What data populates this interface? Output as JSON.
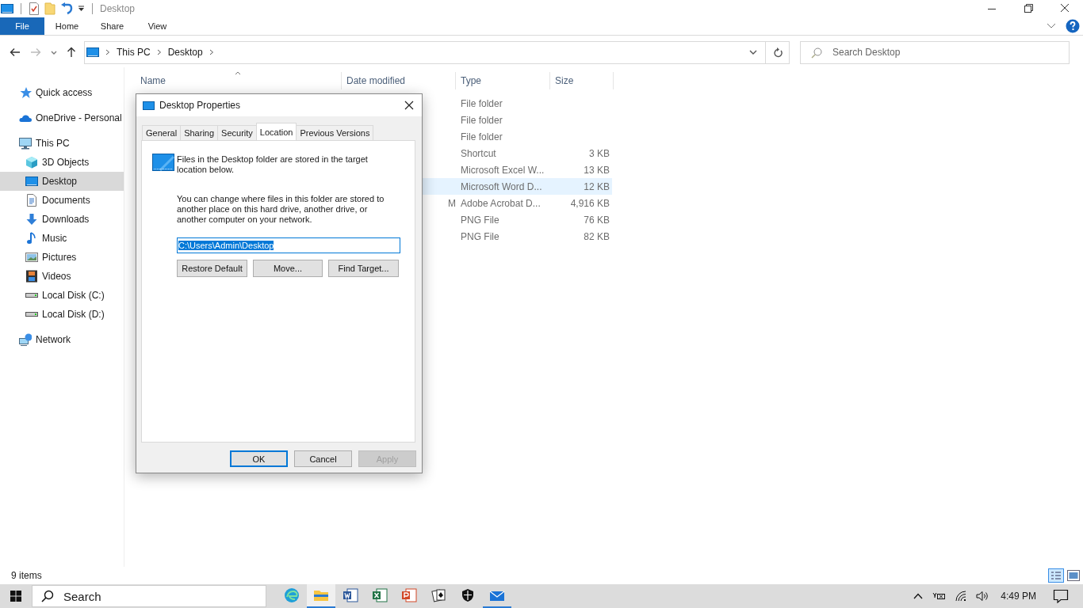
{
  "window": {
    "title": "Desktop"
  },
  "ribbon_tabs": [
    {
      "label": "File",
      "kind": "file",
      "selected": false
    },
    {
      "label": "Home",
      "kind": "tab",
      "selected": false
    },
    {
      "label": "Share",
      "kind": "tab",
      "selected": false
    },
    {
      "label": "View",
      "kind": "tab",
      "selected": false
    }
  ],
  "address": {
    "segments": [
      "This PC",
      "Desktop"
    ]
  },
  "search": {
    "placeholder": "Search Desktop"
  },
  "sidebar": {
    "items": [
      {
        "label": "Quick access",
        "kind": "star",
        "selected": false
      },
      {
        "label": "OneDrive - Personal",
        "kind": "cloud",
        "selected": false
      },
      {
        "label": "This PC",
        "kind": "pc",
        "selected": false,
        "children": [
          {
            "label": "3D Objects",
            "kind": "cube",
            "selected": false
          },
          {
            "label": "Desktop",
            "kind": "desktop",
            "selected": true
          },
          {
            "label": "Documents",
            "kind": "document",
            "selected": false
          },
          {
            "label": "Downloads",
            "kind": "download",
            "selected": false
          },
          {
            "label": "Music",
            "kind": "music",
            "selected": false
          },
          {
            "label": "Pictures",
            "kind": "picture",
            "selected": false
          },
          {
            "label": "Videos",
            "kind": "video",
            "selected": false
          },
          {
            "label": "Local Disk (C:)",
            "kind": "disk",
            "selected": false
          },
          {
            "label": "Local Disk (D:)",
            "kind": "disk",
            "selected": false
          }
        ]
      },
      {
        "label": "Network",
        "kind": "network",
        "selected": false
      }
    ]
  },
  "table": {
    "columns": [
      "Name",
      "Date modified",
      "Type",
      "Size"
    ],
    "rows": [
      {
        "type": "File folder",
        "selected": false
      },
      {
        "type": "File folder",
        "selected": false
      },
      {
        "type": "File folder",
        "selected": false
      },
      {
        "type": "Shortcut",
        "size": "3 KB",
        "selected": false
      },
      {
        "type": "Microsoft Excel W...",
        "size": "13 KB",
        "selected": false
      },
      {
        "type": "Microsoft Word D...",
        "size": "12 KB",
        "selected": true
      },
      {
        "date": "M",
        "type": "Adobe Acrobat D...",
        "size": "4,916 KB",
        "selected": false
      },
      {
        "type": "PNG File",
        "size": "76 KB",
        "selected": false
      },
      {
        "type": "PNG File",
        "size": "82 KB",
        "selected": false
      }
    ]
  },
  "status_bar": {
    "item_count": "9 items"
  },
  "dialog": {
    "title": "Desktop Properties",
    "tabs": [
      {
        "label": "General",
        "selected": false
      },
      {
        "label": "Sharing",
        "selected": false
      },
      {
        "label": "Security",
        "selected": false
      },
      {
        "label": "Location",
        "selected": true
      },
      {
        "label": "Previous Versions",
        "selected": false
      }
    ],
    "message": "Files in the Desktop folder are stored in the target location below.",
    "description": "You can change where files in this folder are stored to another place on this hard drive, another drive, or another computer on your network.",
    "path": "C:\\Users\\Admin\\Desktop",
    "actions": [
      {
        "label": "Restore Default",
        "disabled": false
      },
      {
        "label": "Move...",
        "disabled": false
      },
      {
        "label": "Find Target...",
        "disabled": false
      }
    ],
    "buttons": [
      {
        "label": "OK",
        "default": true,
        "disabled": false
      },
      {
        "label": "Cancel",
        "default": false,
        "disabled": false
      },
      {
        "label": "Apply",
        "default": false,
        "disabled": true
      }
    ]
  },
  "taskbar": {
    "search": "Search",
    "apps": [
      {
        "kind": "edge",
        "open": false,
        "selected": false
      },
      {
        "kind": "explorer",
        "open": true,
        "selected": true
      },
      {
        "kind": "word",
        "open": false,
        "selected": false
      },
      {
        "kind": "excel",
        "open": false,
        "selected": false
      },
      {
        "kind": "powerpoint",
        "open": false,
        "selected": false
      },
      {
        "kind": "cards",
        "open": false,
        "selected": false
      },
      {
        "kind": "shield",
        "open": false,
        "selected": false
      },
      {
        "kind": "mail",
        "open": true,
        "selected": false
      }
    ],
    "time": "4:49 PM"
  }
}
